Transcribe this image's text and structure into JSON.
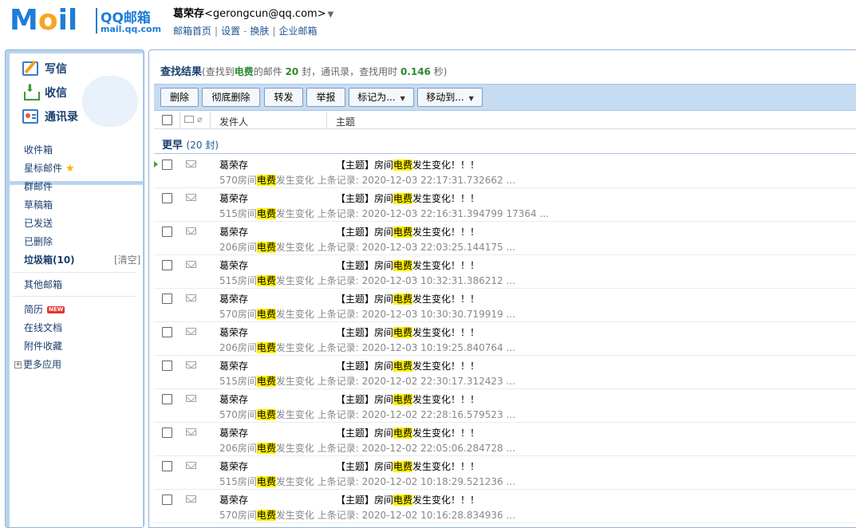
{
  "logo": {
    "moil": [
      "M",
      "o",
      "i",
      "l"
    ],
    "brand": "QQ邮箱",
    "domain": "mail.qq.com"
  },
  "user": {
    "name": "葛荣存",
    "email": "<gerongcun@qq.com>",
    "caret": "▼"
  },
  "toplinks": [
    "邮箱首页",
    "设置",
    "换肤",
    "企业邮箱"
  ],
  "quick": {
    "write": "写信",
    "inbox": "收信",
    "contacts": "通讯录"
  },
  "folders": {
    "inbox": "收件箱",
    "starred": "星标邮件",
    "group": "群邮件",
    "drafts": "草稿箱",
    "sent": "已发送",
    "deleted": "已删除",
    "spam": "垃圾箱(10)",
    "clear": "[清空]",
    "other": "其他邮箱",
    "resume": "简历",
    "resume_badge": "NEW",
    "docs": "在线文档",
    "attachments": "附件收藏",
    "more_apps": "更多应用"
  },
  "search": {
    "title": "查找结果",
    "prefix": "(查找到",
    "keyword": "电费",
    "mid": "的邮件",
    "count": "20",
    "unit": "封，通讯录，查找用时",
    "time": "0.146",
    "suffix": "秒)"
  },
  "toolbar": {
    "delete": "删除",
    "purge": "彻底删除",
    "forward": "转发",
    "report": "举报",
    "mark_as": "标记为...",
    "move_to": "移动到...",
    "arrow": "▼"
  },
  "columns": {
    "sender": "发件人",
    "subject": "主题"
  },
  "group": {
    "label": "更早",
    "count": "(20 封)"
  },
  "emails": [
    {
      "sender": "葛荣存",
      "subj_a": "【主题】房间",
      "subj_hl": "电费",
      "subj_b": "发生变化！！！",
      "prev_a": "570房间",
      "prev_hl": "电费",
      "prev_b": "发生变化 上条记录: 2020-12-03 22:17:31.732662 ..."
    },
    {
      "sender": "葛荣存",
      "subj_a": "【主题】房间",
      "subj_hl": "电费",
      "subj_b": "发生变化！！！",
      "prev_a": "515房间",
      "prev_hl": "电费",
      "prev_b": "发生变化 上条记录: 2020-12-03 22:16:31.394799 17364 ..."
    },
    {
      "sender": "葛荣存",
      "subj_a": "【主题】房间",
      "subj_hl": "电费",
      "subj_b": "发生变化！！！",
      "prev_a": "206房间",
      "prev_hl": "电费",
      "prev_b": "发生变化 上条记录: 2020-12-03 22:03:25.144175 ..."
    },
    {
      "sender": "葛荣存",
      "subj_a": "【主题】房间",
      "subj_hl": "电费",
      "subj_b": "发生变化！！！",
      "prev_a": "515房间",
      "prev_hl": "电费",
      "prev_b": "发生变化 上条记录: 2020-12-03 10:32:31.386212 ..."
    },
    {
      "sender": "葛荣存",
      "subj_a": "【主题】房间",
      "subj_hl": "电费",
      "subj_b": "发生变化！！！",
      "prev_a": "570房间",
      "prev_hl": "电费",
      "prev_b": "发生变化 上条记录: 2020-12-03 10:30:30.719919 ..."
    },
    {
      "sender": "葛荣存",
      "subj_a": "【主题】房间",
      "subj_hl": "电费",
      "subj_b": "发生变化！！！",
      "prev_a": "206房间",
      "prev_hl": "电费",
      "prev_b": "发生变化 上条记录: 2020-12-03 10:19:25.840764 ..."
    },
    {
      "sender": "葛荣存",
      "subj_a": "【主题】房间",
      "subj_hl": "电费",
      "subj_b": "发生变化！！！",
      "prev_a": "515房间",
      "prev_hl": "电费",
      "prev_b": "发生变化 上条记录: 2020-12-02 22:30:17.312423 ..."
    },
    {
      "sender": "葛荣存",
      "subj_a": "【主题】房间",
      "subj_hl": "电费",
      "subj_b": "发生变化！！！",
      "prev_a": "570房间",
      "prev_hl": "电费",
      "prev_b": "发生变化 上条记录: 2020-12-02 22:28:16.579523 ..."
    },
    {
      "sender": "葛荣存",
      "subj_a": "【主题】房间",
      "subj_hl": "电费",
      "subj_b": "发生变化！！！",
      "prev_a": "206房间",
      "prev_hl": "电费",
      "prev_b": "发生变化 上条记录: 2020-12-02 22:05:06.284728 ..."
    },
    {
      "sender": "葛荣存",
      "subj_a": "【主题】房间",
      "subj_hl": "电费",
      "subj_b": "发生变化！！！",
      "prev_a": "515房间",
      "prev_hl": "电费",
      "prev_b": "发生变化 上条记录: 2020-12-02 10:18:29.521236 ..."
    },
    {
      "sender": "葛荣存",
      "subj_a": "【主题】房间",
      "subj_hl": "电费",
      "subj_b": "发生变化！！！",
      "prev_a": "570房间",
      "prev_hl": "电费",
      "prev_b": "发生变化 上条记录: 2020-12-02 10:16:28.834936 ..."
    }
  ]
}
